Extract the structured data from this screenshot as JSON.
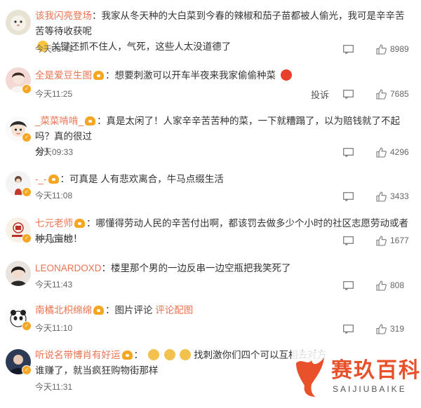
{
  "comments": [
    {
      "user": "该我闪亮登场",
      "text_line1": "我家从冬天种的大白菜到今春的辣椒和茄子苗都被人偷光，我可是辛辛苦苦等待收获呢",
      "text_line2": "关键还抓不住人，气死，这些人太没道德了",
      "time": "今天08:41",
      "likes": "8989"
    },
    {
      "user": "全是爱豆生图",
      "text": "想要刺激可以开车半夜来我家偷偷种菜",
      "time": "今天11:25",
      "report": "投诉",
      "likes": "7685"
    },
    {
      "user": "_菜菜啃啃_",
      "text_line1": "真是太闲了！人家辛辛苦苦种的菜，一下就糟蹋了，以为赔钱就了不起吗？真的很过",
      "text_line2": "分！",
      "time": "今天09:33",
      "likes": "4296"
    },
    {
      "user": "-_-",
      "text": "可真是 人有悲欢离合，牛马点缀生活",
      "time": "今天11:08",
      "likes": "3433"
    },
    {
      "user": "七元老师",
      "text": "哪懂得劳动人民的辛苦付出啊，都该罚去做多少个小时的社区志愿劳动或者种几亩地！",
      "time": "今天09:57",
      "likes": "1677"
    },
    {
      "user": "LEONARDOXD",
      "text": "楼里那个男的一边反串一边空瓶把我笑死了",
      "time": "今天11:43",
      "likes": "808"
    },
    {
      "user": "南橘北枳绵绵",
      "text": "图片评论",
      "link": "评论配图",
      "time": "今天11:10",
      "likes": "319"
    },
    {
      "user": "听说名带博肖有好运",
      "text_line1": "找刺激你们四个可以互相去对方",
      "text_line2": "谁赚了，就当疯狂购物街那样",
      "time": "今天11:31"
    }
  ],
  "watermark": {
    "cn": "赛玖百科",
    "en": "SAIJIUBAIKE",
    "color": "#e8512a"
  },
  "colors": {
    "username": "#eb7350",
    "badge": "#f5a623",
    "text": "#333333",
    "meta": "#666666"
  }
}
